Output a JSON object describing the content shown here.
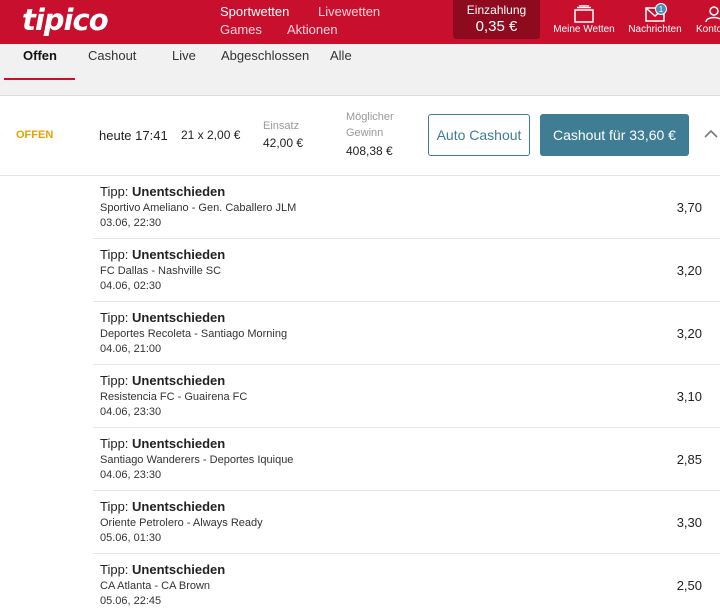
{
  "brand": {
    "logo": "tipico",
    "accent": "#c8102e",
    "button_color": "#3e7d93"
  },
  "header": {
    "nav": [
      {
        "label": "Sportwetten"
      },
      {
        "label": "Livewetten"
      },
      {
        "label": "Games"
      },
      {
        "label": "Aktionen"
      }
    ],
    "deposit": {
      "label": "Einzahlung",
      "amount": "0,35 €"
    },
    "icons": [
      {
        "label": "Meine Wetten",
        "icon": "betslip-icon"
      },
      {
        "label": "Nachrichten",
        "icon": "mail-icon",
        "badge": "1"
      },
      {
        "label": "Konto",
        "icon": "user-icon"
      }
    ]
  },
  "tabs": [
    {
      "label": "Offen",
      "active": true
    },
    {
      "label": "Cashout"
    },
    {
      "label": "Live"
    },
    {
      "label": "Abgeschlossen"
    },
    {
      "label": "Alle"
    }
  ],
  "bet": {
    "status": "OFFEN",
    "time": "heute 17:41",
    "combo": "21 x 2,00 €",
    "stake_label": "Einsatz",
    "stake_value": "42,00 €",
    "win_label_1": "Möglicher",
    "win_label_2": "Gewinn",
    "win_value": "408,38 €",
    "auto_cashout_label": "Auto Cashout",
    "cashout_label": "Cashout für 33,60 €",
    "legs": [
      {
        "tip_prefix": "Tipp:",
        "tip": "Unentschieden",
        "match": "Sportivo Ameliano - Gen. Caballero JLM",
        "date": "03.06, 22:30",
        "odds": "3,70"
      },
      {
        "tip_prefix": "Tipp:",
        "tip": "Unentschieden",
        "match": "FC Dallas - Nashville SC",
        "date": "04.06, 02:30",
        "odds": "3,20"
      },
      {
        "tip_prefix": "Tipp:",
        "tip": "Unentschieden",
        "match": "Deportes Recoleta - Santiago Morning",
        "date": "04.06, 21:00",
        "odds": "3,20"
      },
      {
        "tip_prefix": "Tipp:",
        "tip": "Unentschieden",
        "match": "Resistencia FC - Guairena FC",
        "date": "04.06, 23:30",
        "odds": "3,10"
      },
      {
        "tip_prefix": "Tipp:",
        "tip": "Unentschieden",
        "match": "Santiago Wanderers - Deportes Iquique",
        "date": "04.06, 23:30",
        "odds": "2,85"
      },
      {
        "tip_prefix": "Tipp:",
        "tip": "Unentschieden",
        "match": "Oriente Petrolero - Always Ready",
        "date": "05.06, 01:30",
        "odds": "3,30"
      },
      {
        "tip_prefix": "Tipp:",
        "tip": "Unentschieden",
        "match": "CA Atlanta - CA Brown",
        "date": "05.06, 22:45",
        "odds": "2,50"
      }
    ]
  }
}
